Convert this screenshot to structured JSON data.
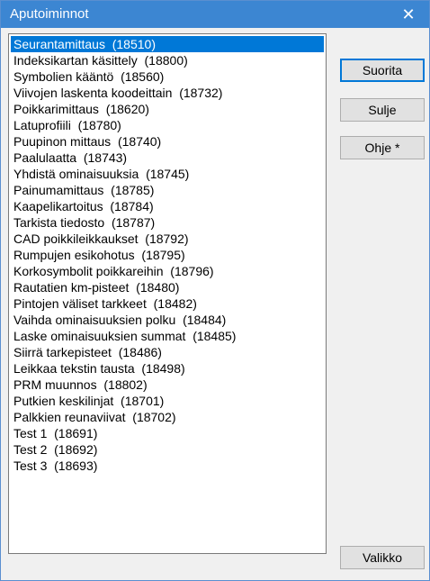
{
  "window": {
    "title": "Aputoiminnot",
    "close_glyph": "✕"
  },
  "list": {
    "selected_index": 0,
    "items": [
      "Seurantamittaus  (18510)",
      "Indeksikartan käsittely  (18800)",
      "Symbolien kääntö  (18560)",
      "Viivojen laskenta koodeittain  (18732)",
      "Poikkarimittaus  (18620)",
      "Latuprofiili  (18780)",
      "Puupinon mittaus  (18740)",
      "Paalulaatta  (18743)",
      "Yhdistä ominaisuuksia  (18745)",
      "Painumamittaus  (18785)",
      "Kaapelikartoitus  (18784)",
      "Tarkista tiedosto  (18787)",
      "CAD poikkileikkaukset  (18792)",
      "Rumpujen esikohotus  (18795)",
      "Korkosymbolit poikkareihin  (18796)",
      "Rautatien km-pisteet  (18480)",
      "Pintojen väliset tarkkeet  (18482)",
      "Vaihda ominaisuuksien polku  (18484)",
      "Laske ominaisuuksien summat  (18485)",
      "Siirrä tarkepisteet  (18486)",
      "Leikkaa tekstin tausta  (18498)",
      "PRM muunnos  (18802)",
      "Putkien keskilinjat  (18701)",
      "Palkkien reunaviivat  (18702)",
      "Test 1  (18691)",
      "Test 2  (18692)",
      "Test 3  (18693)"
    ]
  },
  "buttons": {
    "run": "Suorita",
    "close": "Sulje",
    "help": "Ohje *",
    "menu": "Valikko"
  },
  "colors": {
    "titlebar": "#3c86d2",
    "selection": "#0078d7",
    "dialog_bg": "#f0f0f0"
  }
}
